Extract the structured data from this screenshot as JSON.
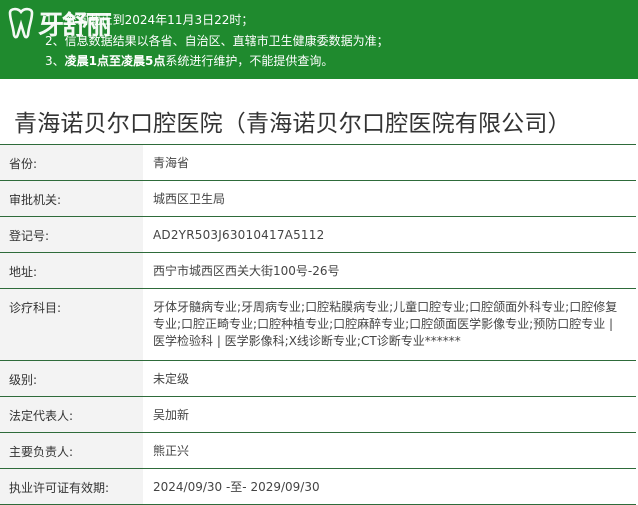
{
  "notice": {
    "logo_text": "牙舒丽",
    "items": [
      {
        "prefix": "1、",
        "text": "查询截止到2024年11月3日22时；"
      },
      {
        "prefix": "2、",
        "text": "信息数据结果以各省、自治区、直辖市卫生健康委数据为准；"
      },
      {
        "prefix": "3、",
        "bold": "凌晨1点至凌晨5点",
        "text": "系统进行维护，不能提供查询。"
      }
    ]
  },
  "title": "青海诺贝尔口腔医院（青海诺贝尔口腔医院有限公司）",
  "rows": [
    {
      "label": "省份:",
      "value": "青海省"
    },
    {
      "label": "审批机关:",
      "value": "城西区卫生局"
    },
    {
      "label": "登记号:",
      "value": "AD2YR503J63010417A5112"
    },
    {
      "label": "地址:",
      "value": "西宁市城西区西关大街100号-26号"
    },
    {
      "label": "诊疗科目:",
      "value": "牙体牙髓病专业;牙周病专业;口腔粘膜病专业;儿童口腔专业;口腔颌面外科专业;口腔修复专业;口腔正畸专业;口腔种植专业;口腔麻醉专业;口腔颌面医学影像专业;预防口腔专业 | 医学检验科 | 医学影像科;X线诊断专业;CT诊断专业******"
    },
    {
      "label": "级别:",
      "value": "未定级"
    },
    {
      "label": "法定代表人:",
      "value": "吴加新"
    },
    {
      "label": "主要负责人:",
      "value": "熊正兴"
    },
    {
      "label": "执业许可证有效期:",
      "value": "2024/09/30 -至- 2029/09/30"
    }
  ],
  "colors": {
    "banner": "#1f8a2e",
    "border": "#2e6b3a",
    "label_bg": "#f3f3f3"
  }
}
